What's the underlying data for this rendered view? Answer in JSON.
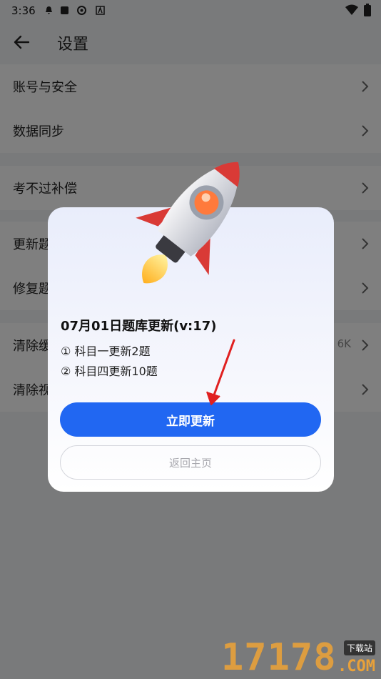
{
  "status_bar": {
    "time": "3:36"
  },
  "app_bar": {
    "title": "设置"
  },
  "sections": [
    {
      "items": [
        {
          "label": "账号与安全",
          "value": ""
        },
        {
          "label": "数据同步",
          "value": ""
        }
      ]
    },
    {
      "items": [
        {
          "label": "考不过补偿",
          "value": ""
        }
      ]
    },
    {
      "items": [
        {
          "label": "更新题",
          "value": ""
        },
        {
          "label": "修复题",
          "value": ""
        }
      ]
    },
    {
      "items": [
        {
          "label": "清除缓",
          "value": "6K"
        },
        {
          "label": "清除视",
          "value": ""
        }
      ]
    }
  ],
  "dialog": {
    "title": "07月01日题库更新(v:17)",
    "lines": [
      "① 科目一更新2题",
      "② 科目四更新10题"
    ],
    "primary_label": "立即更新",
    "secondary_label": "返回主页"
  },
  "watermark": {
    "brand": "17178",
    "domain": ".COM",
    "tag": "下载站"
  },
  "colors": {
    "accent": "#2167f2",
    "arrow": "#e02020"
  }
}
